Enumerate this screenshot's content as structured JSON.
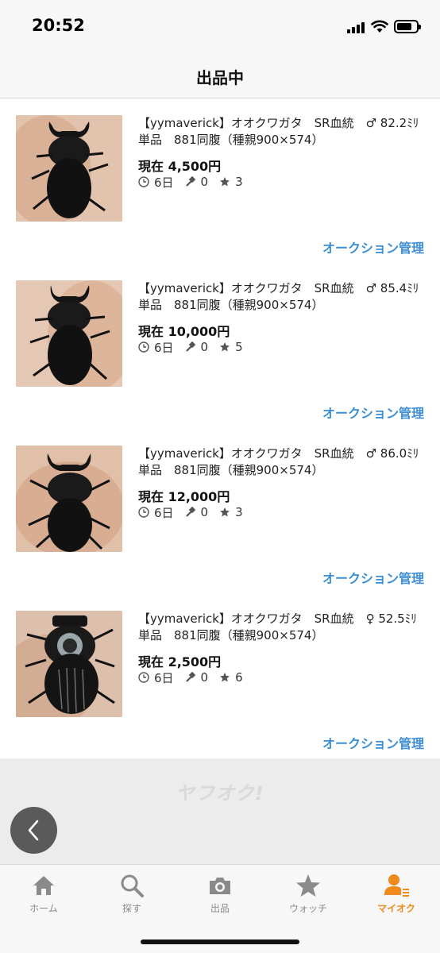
{
  "status_bar": {
    "time": "20:52"
  },
  "header": {
    "title": "出品中"
  },
  "listings": [
    {
      "title": "【yymaverick】オオクワガタ　SR血統　♂ 82.2ﾐﾘ単品　881同腹（種親900×574）",
      "price": "現在 4,500円",
      "time_left": "6日",
      "bids": "0",
      "watch": "3",
      "manage_label": "オークション管理"
    },
    {
      "title": "【yymaverick】オオクワガタ　SR血統　♂ 85.4ﾐﾘ　単品　881同腹（種親900×574）",
      "price": "現在 10,000円",
      "time_left": "6日",
      "bids": "0",
      "watch": "5",
      "manage_label": "オークション管理"
    },
    {
      "title": "【yymaverick】オオクワガタ　SR血統　♂ 86.0ﾐﾘ　単品　881同腹（種親900×574）",
      "price": "現在 12,000円",
      "time_left": "6日",
      "bids": "0",
      "watch": "3",
      "manage_label": "オークション管理"
    },
    {
      "title": "【yymaverick】オオクワガタ　SR血統　♀ 52.5ﾐﾘ単品　881同腹（種親900×574）",
      "price": "現在 2,500円",
      "time_left": "6日",
      "bids": "0",
      "watch": "6",
      "manage_label": "オークション管理"
    }
  ],
  "footer": {
    "logo": "ヤフオク!"
  },
  "tabs": [
    {
      "label": "ホーム",
      "icon": "home-icon"
    },
    {
      "label": "探す",
      "icon": "search-icon"
    },
    {
      "label": "出品",
      "icon": "camera-icon"
    },
    {
      "label": "ウォッチ",
      "icon": "star-icon"
    },
    {
      "label": "マイオク",
      "icon": "user-icon"
    }
  ],
  "colors": {
    "link": "#3d8fd6",
    "active_tab": "#f08a1c",
    "inactive_tab": "#8a8a8a",
    "background": "#ffffff",
    "bars": "#f7f7f7"
  }
}
